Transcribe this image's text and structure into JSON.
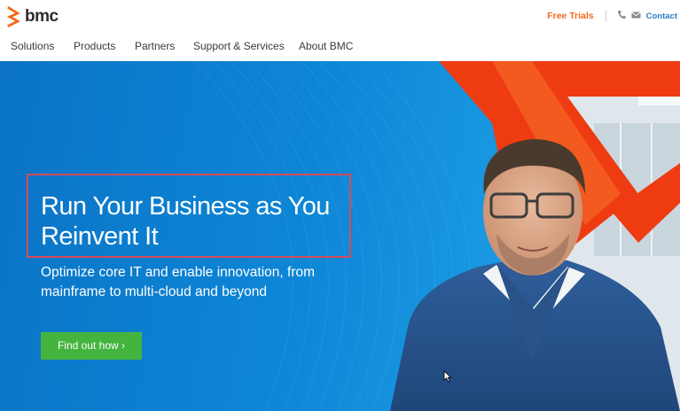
{
  "brand": {
    "name": "bmc",
    "accent": "#f26b21"
  },
  "utility": {
    "free_trials": "Free Trials",
    "contact": "Contact",
    "phone_icon": "phone-icon",
    "mail_icon": "mail-icon"
  },
  "nav": {
    "items": [
      {
        "label": "Solutions"
      },
      {
        "label": "Products"
      },
      {
        "label": "Partners"
      },
      {
        "label": "Support & Services"
      },
      {
        "label": "About BMC"
      }
    ]
  },
  "hero": {
    "headline": "Run Your Business as You Reinvent It",
    "subtext": "Optimize core IT and enable innovation, from mainframe to multi-cloud and beyond",
    "cta_label": "Find out how ›",
    "colors": {
      "background": "#0d86d6",
      "cta": "#44b43f",
      "highlight_border": "#d64b59",
      "accent_shape": "#ee3b12"
    }
  }
}
